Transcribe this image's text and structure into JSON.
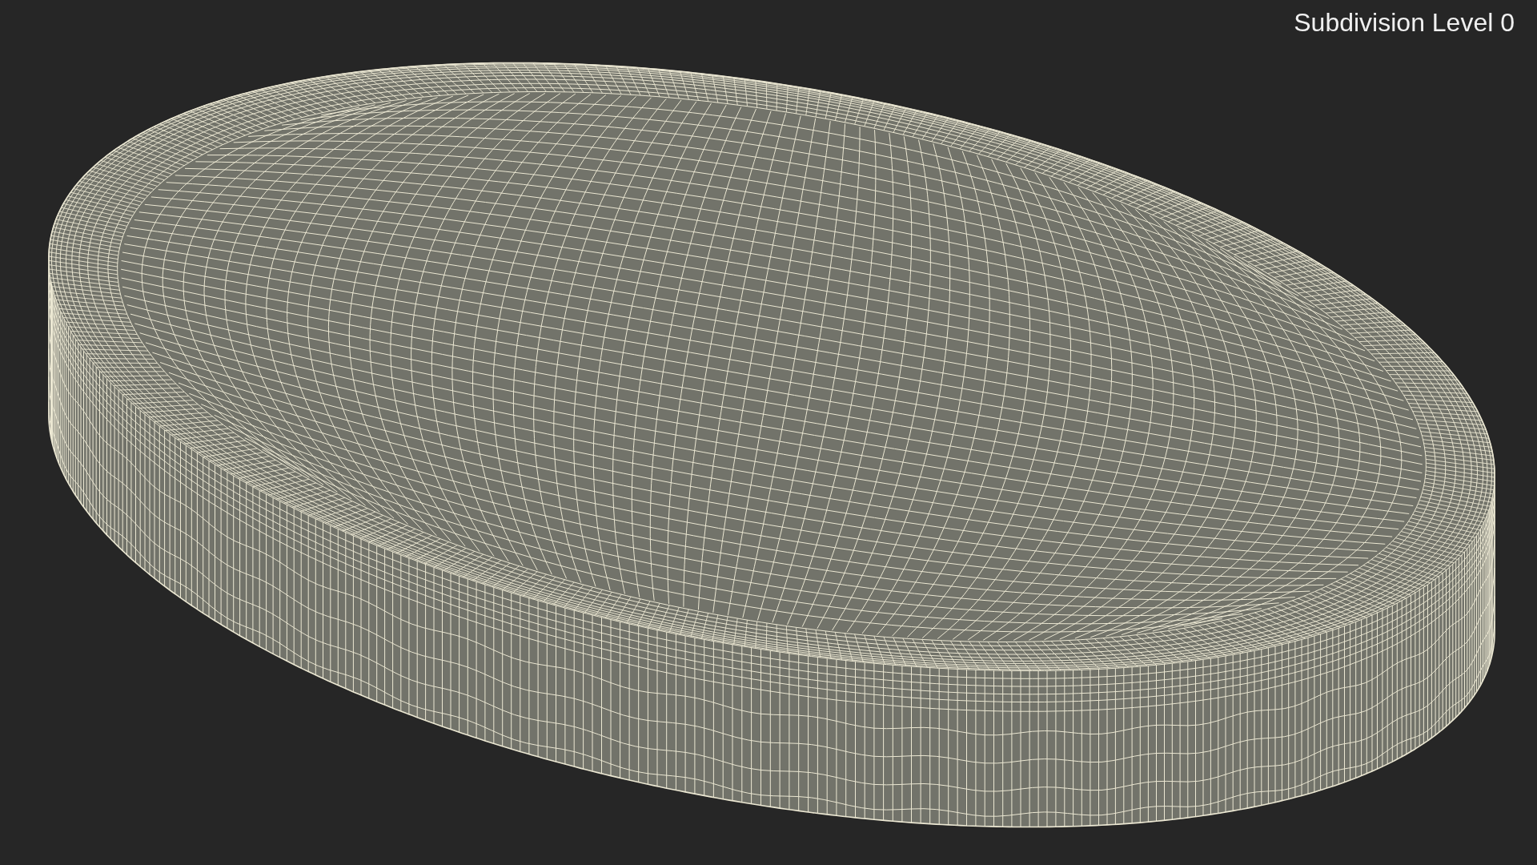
{
  "viewport_overlay": {
    "text": "Subdivision Level 0"
  }
}
